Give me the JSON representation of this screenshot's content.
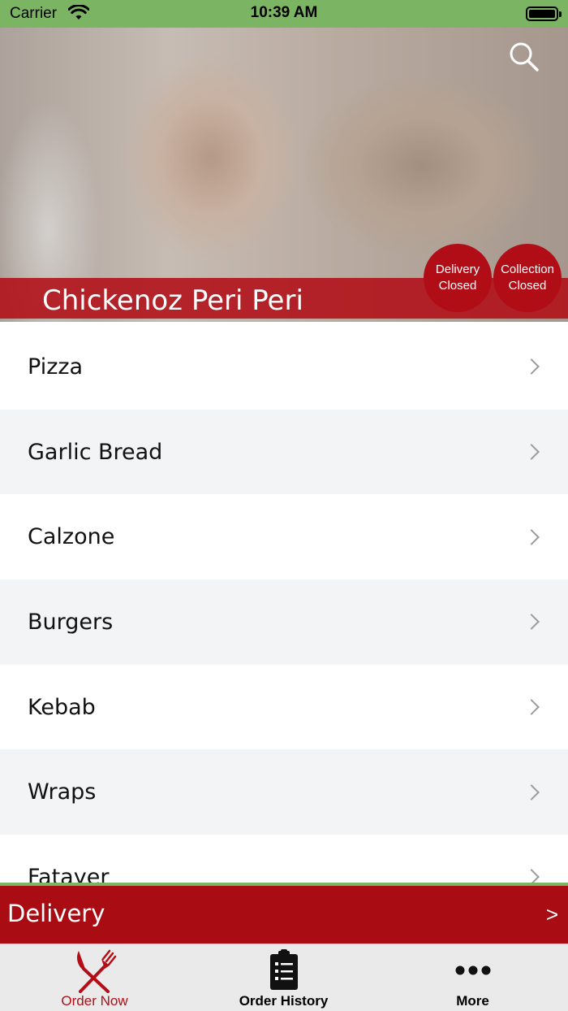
{
  "status_bar": {
    "carrier": "Carrier",
    "time": "10:39 AM",
    "wifi_icon": "wifi-icon",
    "battery_icon": "battery-icon"
  },
  "header": {
    "restaurant_name": "Chickenoz Peri Peri",
    "search_icon": "search-icon",
    "delivery_badge": {
      "line1": "Delivery",
      "line2": "Closed"
    },
    "collection_badge": {
      "line1": "Collection",
      "line2": "Closed"
    }
  },
  "menu": {
    "categories": [
      {
        "label": "Pizza"
      },
      {
        "label": "Garlic Bread"
      },
      {
        "label": "Calzone"
      },
      {
        "label": "Burgers"
      },
      {
        "label": "Kebab"
      },
      {
        "label": "Wraps"
      },
      {
        "label": "Fatayer"
      }
    ],
    "chevron_icon": "chevron-right-icon"
  },
  "order_mode": {
    "label": "Delivery",
    "arrow": ">"
  },
  "tab_bar": {
    "tabs": [
      {
        "label": "Order Now",
        "icon": "fork-knife-icon",
        "active": true
      },
      {
        "label": "Order History",
        "icon": "clipboard-list-icon",
        "active": false
      },
      {
        "label": "More",
        "icon": "more-dots-icon",
        "active": false
      }
    ]
  },
  "colors": {
    "brand_red": "#a90c13",
    "status_green": "#7bb463",
    "active_tab": "#b30d16"
  }
}
